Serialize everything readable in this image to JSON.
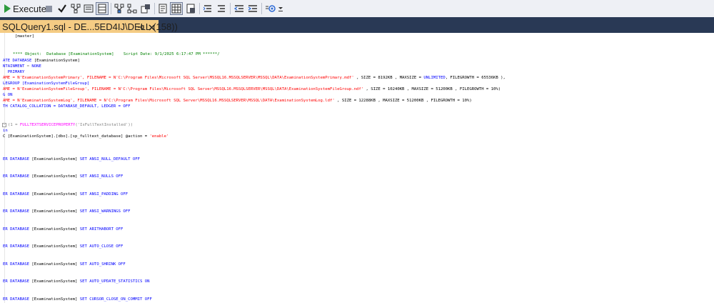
{
  "toolbar": {
    "execute_label": "Execute"
  },
  "tab": {
    "title": "SQLQuery1.sql - DE...5ED4IJ\\DELL (158))"
  },
  "editor": {
    "lines": {
      "l01": "[master]",
      "l02a": "**** Object:  Database [ExaminationSystem]    Script Date: 9/1/2025 6:17:47 PM ******/",
      "l03a": "ATE DATABASE",
      "l03b": " [ExaminationSystem]",
      "l04a": "NTAINMENT",
      "l04b": " = ",
      "l04c": "NONE",
      "l05a": "  PRIMARY",
      "l06a": "AME = N'ExaminationSystemPrimary'",
      "l06b": ", FILENAME = N'C:\\Program Files\\Microsoft SQL Server\\MSSQL16.MSSQLSERVER\\MSSQL\\DATA\\ExaminationSystemPrimary.mdf'",
      "l06c": " , SIZE = 8192KB , MAXSIZE = ",
      "l06d": "UNLIMITED",
      "l06e": ", FILEGROWTH = 65536KB ),",
      "l07a": "LEGROUP [ExaminationSystemFileGroup]",
      "l08a": "AME = N'ExaminationSystemFileGroup', FILENAME = N'C:\\Program Files\\Microsoft SQL Server\\MSSQL16.MSSQLSERVER\\MSSQL\\DATA\\ExaminationSystemFileGroup.ndf'",
      "l08b": " , SIZE = 10240KB , MAXSIZE = 51200KB , FILEGROWTH = 10%)",
      "l09a": "G ON",
      "l10a": "AME = N'ExaminationSystemLog', FILENAME = N'C:\\Program Files\\Microsoft SQL Server\\MSSQL16.MSSQLSERVER\\MSSQL\\DATA\\ExaminationSystemLog.ldf'",
      "l10b": " , SIZE = 12288KB , MAXSIZE = 51200KB , FILEGROWTH = 10%)",
      "l11a": "TH CATALOG_COLLATION = DATABASE_DEFAULT, LEDGER = OFF",
      "l12a": "(1 = ",
      "l12b": "FULLTEXTSERVICEPROPERTY",
      "l12c": "('IsFullTextInstalled'))",
      "l13a": "in",
      "l14a": "C [ExaminationSystem].[dbo].[sp_fulltext_database] @action = ",
      "l14b": "'enable'"
    },
    "alter_prefix": "ER DATABASE",
    "alter_db": " [ExaminationSystem] ",
    "alter_set": "SET",
    "alters": [
      "ANSI_NULL_DEFAULT OFF",
      "ANSI_NULLS OFF",
      "ANSI_PADDING OFF",
      "ANSI_WARNINGS OFF",
      "ARITHABORT OFF",
      "AUTO_CLOSE OFF",
      "AUTO_SHRINK OFF",
      "AUTO_UPDATE_STATISTICS ON",
      "CURSOR_CLOSE_ON_COMMIT OFF"
    ]
  },
  "colors": {
    "keyword": "#0000ff",
    "string": "#ff0000",
    "comment": "#008000",
    "tab_active": "#f5cc84",
    "tab_strip": "#293955",
    "toolbar": "#eef0f5"
  }
}
